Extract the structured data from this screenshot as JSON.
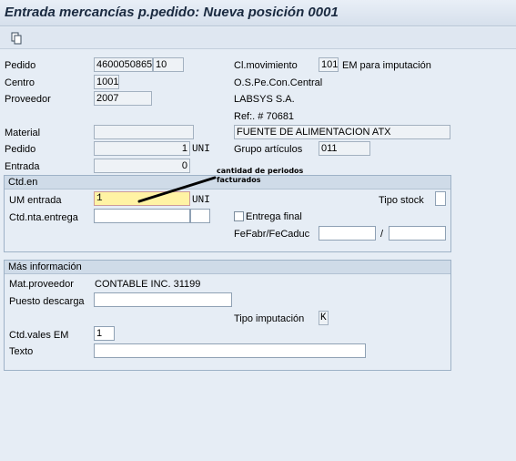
{
  "window": {
    "title": "Entrada mercancías p.pedido: Nueva posición 0001"
  },
  "toolbar": {
    "copy_icon": "copy-icon"
  },
  "header": {
    "pedido_label": "Pedido",
    "pedido_value": "4600050865",
    "pedido_pos": "10",
    "centro_label": "Centro",
    "centro_value": "1001",
    "proveedor_label": "Proveedor",
    "proveedor_value": "2007",
    "clmov_label": "Cl.movimiento",
    "clmov_value": "101",
    "clmov_text": "EM para imputación",
    "centro_text": "O.S.Pe.Con.Central",
    "proveedor_text": "LABSYS S.A.",
    "ref_text": "Ref:. # 70681"
  },
  "material": {
    "material_label": "Material",
    "material_value": "",
    "material_desc": "FUENTE DE ALIMENTACION ATX",
    "pedido_label": "Pedido",
    "pedido_qty": "1",
    "pedido_unit": "UNI",
    "grupo_label": "Grupo artículos",
    "grupo_value": "011",
    "entrada_label": "Entrada",
    "entrada_qty": "0"
  },
  "ctd": {
    "header": "Ctd.en",
    "um_label": "UM entrada",
    "um_value": "1",
    "um_unit": "UNI",
    "tipo_stock_label": "Tipo stock",
    "tipo_stock_value": "",
    "nta_label": "Ctd.nta.entrega",
    "nta_value": "",
    "nta_unit": "",
    "entrega_final_label": "Entrega final",
    "fefabr_label": "FeFabr/FeCaduc",
    "fefabr_value": "",
    "separator": "/",
    "fecaduc_value": ""
  },
  "annotation": {
    "text": "cantidad de periodos facturados"
  },
  "mas": {
    "header": "Más información",
    "matprov_label": "Mat.proveedor",
    "matprov_value": "CONTABLE INC. 31199",
    "puesto_label": "Puesto descarga",
    "puesto_value": "",
    "tipo_imput_label": "Tipo imputación",
    "tipo_imput_value": "K",
    "vales_label": "Ctd.vales EM",
    "vales_value": "1",
    "texto_label": "Texto",
    "texto_value": ""
  }
}
